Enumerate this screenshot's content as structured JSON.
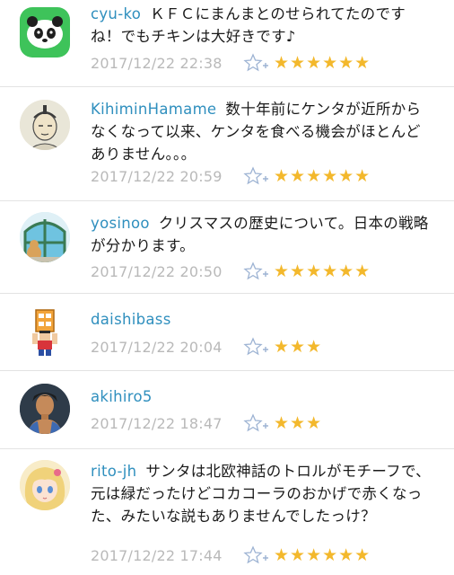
{
  "comments": [
    {
      "user": "cyu-ko",
      "body": "ＫＦＣにまんまとのせられてたのですね！でもチキンは大好きです♪",
      "time": "2017/12/22 22:38",
      "stars": "★★★★★★"
    },
    {
      "user": "KihiminHamame",
      "body": "数十年前にケンタが近所からなくなって以来、ケンタを食べる機会がほとんどありません。。。",
      "time": "2017/12/22 20:59",
      "stars": "★★★★★★"
    },
    {
      "user": "yosinoo",
      "body": "クリスマスの歴史について。日本の戦略が分かります。",
      "time": "2017/12/22 20:50",
      "stars": "★★★★★★"
    },
    {
      "user": "daishibass",
      "body": "",
      "time": "2017/12/22 20:04",
      "stars": "★★★"
    },
    {
      "user": "akihiro5",
      "body": "",
      "time": "2017/12/22 18:47",
      "stars": "★★★"
    },
    {
      "user": "rito-jh",
      "body": "サンタは北欧神話のトロルがモチーフで、元は緑だったけどコカコーラのおかげで赤くなった、みたいな説もありませんでしたっけ？",
      "time": "2017/12/22 17:44",
      "stars": "★★★★★★"
    }
  ],
  "icons": {
    "avatars": [
      "panda-avatar",
      "samurai-avatar",
      "window-cat-avatar",
      "pixel-character-avatar",
      "anime-man-avatar",
      "anime-girl-avatar"
    ],
    "favorite": "star-plus-icon"
  },
  "colors": {
    "username": "#2f8fbe",
    "timestamp": "#b9b9b9",
    "star": "#f3b82c",
    "divider": "#e3e3e3"
  }
}
